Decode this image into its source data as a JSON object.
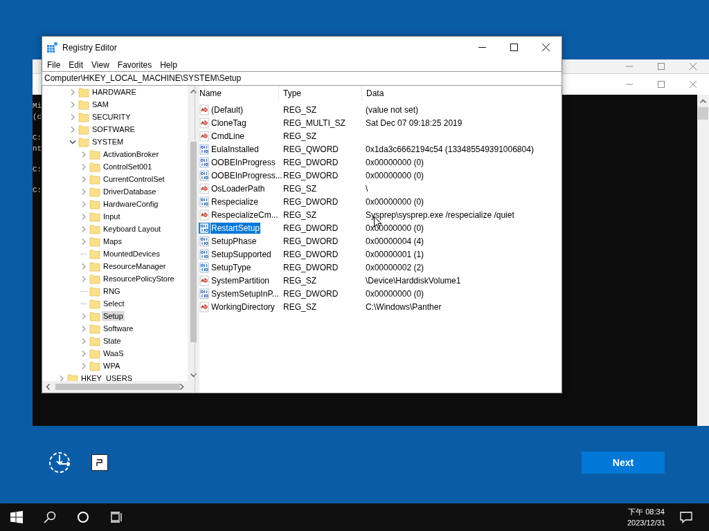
{
  "console": {
    "paragraphs": [
      [
        "Mi",
        "(c"
      ],
      [
        "C:",
        "nt"
      ],
      [
        "C:"
      ],
      [
        "C:"
      ]
    ]
  },
  "registry_editor": {
    "title": "Registry Editor",
    "menu": [
      "File",
      "Edit",
      "View",
      "Favorites",
      "Help"
    ],
    "address": "Computer\\HKEY_LOCAL_MACHINE\\SYSTEM\\Setup",
    "tree": [
      {
        "children": [
          {
            "label": "HARDWARE",
            "expandable": true,
            "expanded": false,
            "selected": false
          },
          {
            "label": "SAM",
            "expandable": true,
            "expanded": false,
            "selected": false
          },
          {
            "label": "SECURITY",
            "expandable": true,
            "expanded": false,
            "selected": false
          },
          {
            "label": "SOFTWARE",
            "expandable": true,
            "expanded": false,
            "selected": false
          },
          {
            "label": "SYSTEM",
            "expandable": true,
            "expanded": true,
            "selected": false,
            "children": [
              {
                "label": "ActivationBroker",
                "expandable": true,
                "expanded": false,
                "selected": false
              },
              {
                "label": "ControlSet001",
                "expandable": true,
                "expanded": false,
                "selected": false
              },
              {
                "label": "CurrentControlSet",
                "expandable": true,
                "expanded": false,
                "selected": false
              },
              {
                "label": "DriverDatabase",
                "expandable": true,
                "expanded": false,
                "selected": false
              },
              {
                "label": "HardwareConfig",
                "expandable": true,
                "expanded": false,
                "selected": false
              },
              {
                "label": "Input",
                "expandable": true,
                "expanded": false,
                "selected": false
              },
              {
                "label": "Keyboard Layout",
                "expandable": true,
                "expanded": false,
                "selected": false
              },
              {
                "label": "Maps",
                "expandable": true,
                "expanded": false,
                "selected": false
              },
              {
                "label": "MountedDevices",
                "expandable": false,
                "selected": false
              },
              {
                "label": "ResourceManager",
                "expandable": true,
                "expanded": false,
                "selected": false
              },
              {
                "label": "ResourcePolicyStore",
                "expandable": true,
                "expanded": false,
                "selected": false
              },
              {
                "label": "RNG",
                "expandable": false,
                "selected": false
              },
              {
                "label": "Select",
                "expandable": false,
                "selected": false
              },
              {
                "label": "Setup",
                "expandable": true,
                "expanded": false,
                "selected": true
              },
              {
                "label": "Software",
                "expandable": true,
                "expanded": false,
                "selected": false
              },
              {
                "label": "State",
                "expandable": true,
                "expanded": false,
                "selected": false
              },
              {
                "label": "WaaS",
                "expandable": true,
                "expanded": false,
                "selected": false
              },
              {
                "label": "WPA",
                "expandable": true,
                "expanded": false,
                "selected": false
              }
            ]
          }
        ]
      },
      {
        "label": "HKEY_USERS",
        "expandable": true,
        "expanded": false,
        "selected": false
      }
    ],
    "columns": [
      "Name",
      "Type",
      "Data"
    ],
    "values": [
      {
        "kind": "string",
        "name": "(Default)",
        "type": "REG_SZ",
        "data": "(value not set)",
        "selected": false
      },
      {
        "kind": "string",
        "name": "CloneTag",
        "type": "REG_MULTI_SZ",
        "data": "Sat Dec 07 09:18:25 2019",
        "selected": false
      },
      {
        "kind": "string",
        "name": "CmdLine",
        "type": "REG_SZ",
        "selected": false
      },
      {
        "kind": "number",
        "name": "EulaInstalled",
        "type": "REG_QWORD",
        "data": "0x1da3c6662194c54 (133485549391006804)",
        "selected": false
      },
      {
        "kind": "number",
        "name": "OOBEInProgress",
        "type": "REG_DWORD",
        "data": "0x00000000 (0)",
        "selected": false
      },
      {
        "kind": "number",
        "name": "OOBEInProgress...",
        "type": "REG_DWORD",
        "data": "0x00000000 (0)",
        "selected": false
      },
      {
        "kind": "string",
        "name": "OsLoaderPath",
        "type": "REG_SZ",
        "data": "\\",
        "selected": false
      },
      {
        "kind": "number",
        "name": "Respecialize",
        "type": "REG_DWORD",
        "data": "0x00000000 (0)",
        "selected": false
      },
      {
        "kind": "string",
        "name": "RespecializeCm...",
        "type": "REG_SZ",
        "data": "Sysprep\\sysprep.exe /respecialize /quiet",
        "selected": false
      },
      {
        "kind": "number",
        "name": "RestartSetup",
        "type": "REG_DWORD",
        "data": "0x00000000 (0)",
        "selected": true
      },
      {
        "kind": "number",
        "name": "SetupPhase",
        "type": "REG_DWORD",
        "data": "0x00000004 (4)",
        "selected": false
      },
      {
        "kind": "number",
        "name": "SetupSupported",
        "type": "REG_DWORD",
        "data": "0x00000001 (1)",
        "selected": false
      },
      {
        "kind": "number",
        "name": "SetupType",
        "type": "REG_DWORD",
        "data": "0x00000002 (2)",
        "selected": false
      },
      {
        "kind": "string",
        "name": "SystemPartition",
        "type": "REG_SZ",
        "data": "\\Device\\HarddiskVolume1",
        "selected": false
      },
      {
        "kind": "number",
        "name": "SystemSetupInP...",
        "type": "REG_DWORD",
        "data": "0x00000000 (0)",
        "selected": false
      },
      {
        "kind": "string",
        "name": "WorkingDirectory",
        "type": "REG_SZ",
        "data": "C:\\Windows\\Panther",
        "selected": false
      }
    ]
  },
  "setup": {
    "next_button": "Next"
  },
  "taskbar": {
    "time": "下午 08:34",
    "date": "2023/12/31"
  }
}
